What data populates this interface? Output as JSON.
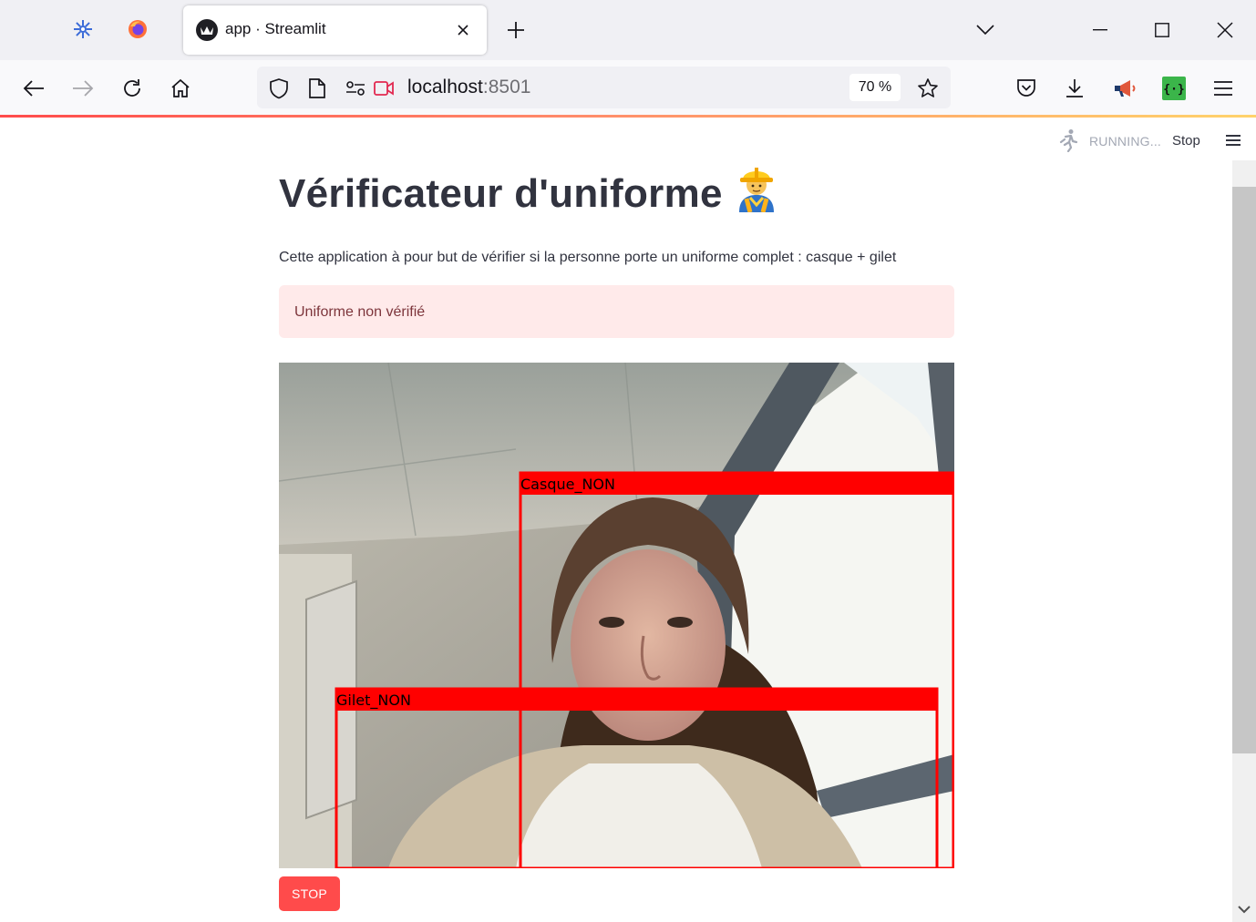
{
  "browser": {
    "tab": {
      "title": "app · Streamlit"
    },
    "new_tab_symbol": "+",
    "url": {
      "host": "localhost",
      "port": ":8501"
    },
    "zoom": "70 %",
    "icons": {
      "pinned_1": "gear-flower-icon",
      "pinned_2": "firefox-icon",
      "back": "back-arrow-icon",
      "forward": "forward-arrow-icon",
      "reload": "reload-icon",
      "home": "home-icon",
      "shield": "tracking-shield-icon",
      "page": "page-icon",
      "permissions": "permissions-icon",
      "camera": "camera-sharing-icon",
      "bookmark": "star-icon",
      "pocket": "pocket-icon",
      "downloads": "download-icon",
      "extension_1": "megaphone-icon",
      "extension_2": "json-extension-icon",
      "menu": "hamburger-menu-icon"
    }
  },
  "streamlit": {
    "status": "RUNNING...",
    "stop_label": "Stop",
    "title": "Vérificateur d'uniforme",
    "title_emoji": "construction-worker-emoji",
    "description": "Cette application à pour but de vérifier si la personne porte un uniforme complet : casque + gilet",
    "alert": "Uniforme non vérifié",
    "detections": [
      {
        "label": "Casque_NON"
      },
      {
        "label": "Gilet_NON"
      }
    ],
    "stop_button": "STOP"
  },
  "colors": {
    "accent": "#ff4b4b",
    "alert_bg": "#ffeaea",
    "alert_text": "#7d353b",
    "box": "#ff0000"
  }
}
